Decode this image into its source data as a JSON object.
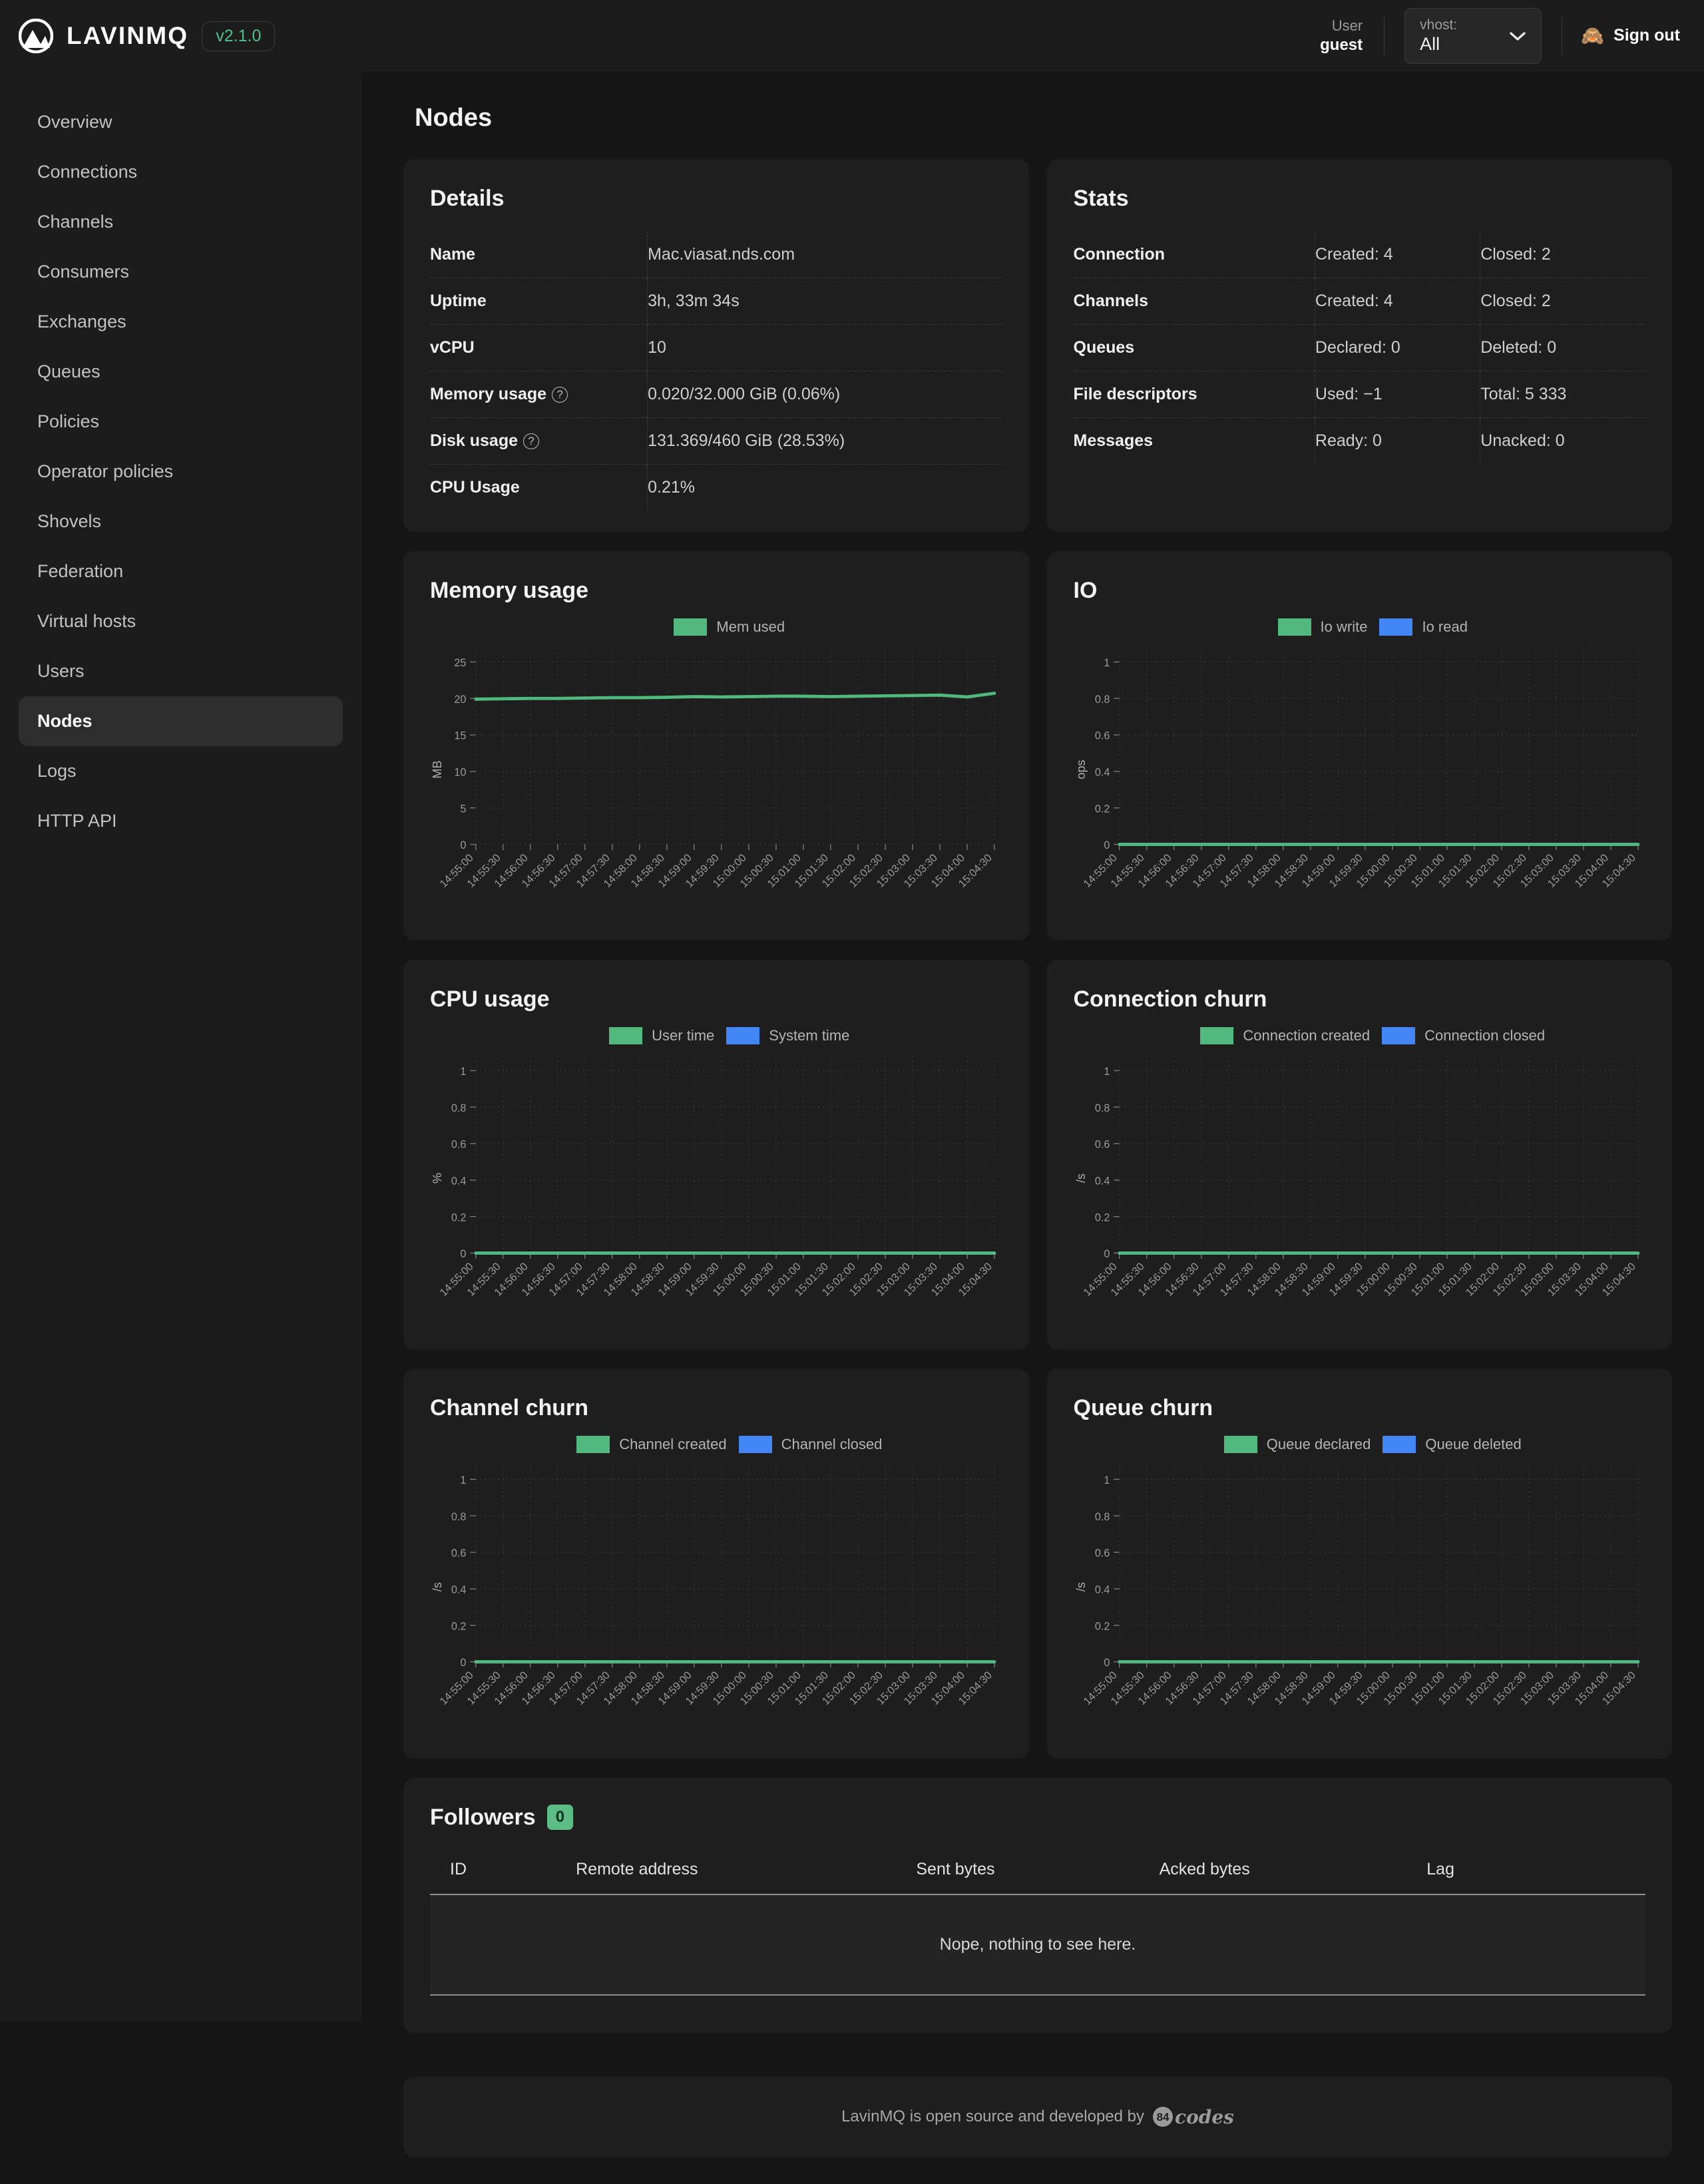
{
  "brand": {
    "name": "LAVINMQ",
    "version": "v2.1.0",
    "logo_icon": "lavinmq-logo-icon"
  },
  "header": {
    "user_label": "User",
    "user_name": "guest",
    "vhost_label": "vhost:",
    "vhost_value": "All",
    "vhost_options": [
      "All"
    ],
    "chevron_icon": "chevron-down-icon",
    "signout_icon": "monkey-icon",
    "signout_label": "Sign out"
  },
  "sidebar": {
    "items": [
      {
        "label": "Overview",
        "active": false
      },
      {
        "label": "Connections",
        "active": false
      },
      {
        "label": "Channels",
        "active": false
      },
      {
        "label": "Consumers",
        "active": false
      },
      {
        "label": "Exchanges",
        "active": false
      },
      {
        "label": "Queues",
        "active": false
      },
      {
        "label": "Policies",
        "active": false
      },
      {
        "label": "Operator policies",
        "active": false
      },
      {
        "label": "Shovels",
        "active": false
      },
      {
        "label": "Federation",
        "active": false
      },
      {
        "label": "Virtual hosts",
        "active": false
      },
      {
        "label": "Users",
        "active": false
      },
      {
        "label": "Nodes",
        "active": true
      },
      {
        "label": "Logs",
        "active": false
      },
      {
        "label": "HTTP API",
        "active": false
      }
    ]
  },
  "page": {
    "title": "Nodes"
  },
  "details": {
    "title": "Details",
    "rows": [
      {
        "key": "Name",
        "help": false,
        "value": "Mac.viasat.nds.com"
      },
      {
        "key": "Uptime",
        "help": false,
        "value": "3h, 33m 34s"
      },
      {
        "key": "vCPU",
        "help": false,
        "value": "10"
      },
      {
        "key": "Memory usage",
        "help": true,
        "value": "0.020/32.000 GiB (0.06%)"
      },
      {
        "key": "Disk usage",
        "help": true,
        "value": "131.369/460 GiB (28.53%)"
      },
      {
        "key": "CPU Usage",
        "help": false,
        "value": "0.21%"
      }
    ],
    "help_glyph": "?"
  },
  "stats": {
    "title": "Stats",
    "rows": [
      {
        "key": "Connection",
        "col1": "Created: 4",
        "col2": "Closed: 2"
      },
      {
        "key": "Channels",
        "col1": "Created: 4",
        "col2": "Closed: 2"
      },
      {
        "key": "Queues",
        "col1": "Declared: 0",
        "col2": "Deleted: 0"
      },
      {
        "key": "File descriptors",
        "col1": "Used: −1",
        "col2": "Total: 5 333"
      },
      {
        "key": "Messages",
        "col1": "Ready: 0",
        "col2": "Unacked: 0"
      }
    ]
  },
  "followers": {
    "title": "Followers",
    "count": "0",
    "columns": [
      "ID",
      "Remote address",
      "Sent bytes",
      "Acked bytes",
      "Lag"
    ],
    "empty_text": "Nope, nothing to see here."
  },
  "footer": {
    "text": "LavinMQ is open source and developed by",
    "logo_badge": "84",
    "logo_word": "codes"
  },
  "colors": {
    "green": "#52b97e",
    "blue": "#4285f4",
    "card_bg": "#1e1e1e",
    "page_bg": "#151515",
    "panel_bg": "#1c1c1c",
    "accent": "#4fc08d"
  },
  "chart_data": [
    {
      "id": "memory-usage",
      "type": "line",
      "title": "Memory usage",
      "ylabel": "MB",
      "xlabel": "",
      "ylim": [
        0,
        27
      ],
      "yticks": [
        0,
        5,
        10,
        15,
        20,
        25
      ],
      "grid": true,
      "legend_position": "top-center",
      "x": [
        "14:55:00",
        "14:55:30",
        "14:56:00",
        "14:56:30",
        "14:57:00",
        "14:57:30",
        "14:58:00",
        "14:58:30",
        "14:59:00",
        "14:59:30",
        "15:00:00",
        "15:00:30",
        "15:01:00",
        "15:01:30",
        "15:02:00",
        "15:02:30",
        "15:03:00",
        "15:03:30",
        "15:04:00",
        "15:04:30"
      ],
      "series": [
        {
          "name": "Mem used",
          "color": "#52b97e",
          "values": [
            19.9,
            19.95,
            20.0,
            20.0,
            20.05,
            20.1,
            20.1,
            20.15,
            20.25,
            20.2,
            20.25,
            20.3,
            20.3,
            20.25,
            20.3,
            20.35,
            20.4,
            20.45,
            20.2,
            20.7
          ]
        }
      ]
    },
    {
      "id": "io",
      "type": "line",
      "title": "IO",
      "ylabel": "ops",
      "xlabel": "",
      "ylim": [
        0,
        1.08
      ],
      "yticks": [
        0,
        0.2,
        0.4,
        0.6,
        0.8,
        1
      ],
      "grid": true,
      "legend_position": "top-center",
      "x": [
        "14:55:00",
        "14:55:30",
        "14:56:00",
        "14:56:30",
        "14:57:00",
        "14:57:30",
        "14:58:00",
        "14:58:30",
        "14:59:00",
        "14:59:30",
        "15:00:00",
        "15:00:30",
        "15:01:00",
        "15:01:30",
        "15:02:00",
        "15:02:30",
        "15:03:00",
        "15:03:30",
        "15:04:00",
        "15:04:30"
      ],
      "series": [
        {
          "name": "Io write",
          "color": "#52b97e",
          "values": [
            0,
            0,
            0,
            0,
            0,
            0,
            0,
            0,
            0,
            0,
            0,
            0,
            0,
            0,
            0,
            0,
            0,
            0,
            0,
            0
          ]
        },
        {
          "name": "Io read",
          "color": "#4285f4",
          "values": [
            0,
            0,
            0,
            0,
            0,
            0,
            0,
            0,
            0,
            0,
            0,
            0,
            0,
            0,
            0,
            0,
            0,
            0,
            0,
            0
          ]
        }
      ]
    },
    {
      "id": "cpu-usage",
      "type": "line",
      "title": "CPU usage",
      "ylabel": "%",
      "xlabel": "",
      "ylim": [
        0,
        1.08
      ],
      "yticks": [
        0,
        0.2,
        0.4,
        0.6,
        0.8,
        1
      ],
      "grid": true,
      "legend_position": "top-center",
      "x": [
        "14:55:00",
        "14:55:30",
        "14:56:00",
        "14:56:30",
        "14:57:00",
        "14:57:30",
        "14:58:00",
        "14:58:30",
        "14:59:00",
        "14:59:30",
        "15:00:00",
        "15:00:30",
        "15:01:00",
        "15:01:30",
        "15:02:00",
        "15:02:30",
        "15:03:00",
        "15:03:30",
        "15:04:00",
        "15:04:30"
      ],
      "series": [
        {
          "name": "User time",
          "color": "#52b97e",
          "values": [
            0,
            0,
            0,
            0,
            0,
            0,
            0,
            0,
            0,
            0,
            0,
            0,
            0,
            0,
            0,
            0,
            0,
            0,
            0,
            0
          ]
        },
        {
          "name": "System time",
          "color": "#4285f4",
          "values": [
            0,
            0,
            0,
            0,
            0,
            0,
            0,
            0,
            0,
            0,
            0,
            0,
            0,
            0,
            0,
            0,
            0,
            0,
            0,
            0
          ]
        }
      ]
    },
    {
      "id": "connection-churn",
      "type": "line",
      "title": "Connection churn",
      "ylabel": "/s",
      "xlabel": "",
      "ylim": [
        0,
        1.08
      ],
      "yticks": [
        0,
        0.2,
        0.4,
        0.6,
        0.8,
        1
      ],
      "grid": true,
      "legend_position": "top-center",
      "x": [
        "14:55:00",
        "14:55:30",
        "14:56:00",
        "14:56:30",
        "14:57:00",
        "14:57:30",
        "14:58:00",
        "14:58:30",
        "14:59:00",
        "14:59:30",
        "15:00:00",
        "15:00:30",
        "15:01:00",
        "15:01:30",
        "15:02:00",
        "15:02:30",
        "15:03:00",
        "15:03:30",
        "15:04:00",
        "15:04:30"
      ],
      "series": [
        {
          "name": "Connection created",
          "color": "#52b97e",
          "values": [
            0,
            0,
            0,
            0,
            0,
            0,
            0,
            0,
            0,
            0,
            0,
            0,
            0,
            0,
            0,
            0,
            0,
            0,
            0,
            0
          ]
        },
        {
          "name": "Connection closed",
          "color": "#4285f4",
          "values": [
            0,
            0,
            0,
            0,
            0,
            0,
            0,
            0,
            0,
            0,
            0,
            0,
            0,
            0,
            0,
            0,
            0,
            0,
            0,
            0
          ]
        }
      ]
    },
    {
      "id": "channel-churn",
      "type": "line",
      "title": "Channel churn",
      "ylabel": "/s",
      "xlabel": "",
      "ylim": [
        0,
        1.08
      ],
      "yticks": [
        0,
        0.2,
        0.4,
        0.6,
        0.8,
        1
      ],
      "grid": true,
      "legend_position": "top-center",
      "x": [
        "14:55:00",
        "14:55:30",
        "14:56:00",
        "14:56:30",
        "14:57:00",
        "14:57:30",
        "14:58:00",
        "14:58:30",
        "14:59:00",
        "14:59:30",
        "15:00:00",
        "15:00:30",
        "15:01:00",
        "15:01:30",
        "15:02:00",
        "15:02:30",
        "15:03:00",
        "15:03:30",
        "15:04:00",
        "15:04:30"
      ],
      "series": [
        {
          "name": "Channel created",
          "color": "#52b97e",
          "values": [
            0,
            0,
            0,
            0,
            0,
            0,
            0,
            0,
            0,
            0,
            0,
            0,
            0,
            0,
            0,
            0,
            0,
            0,
            0,
            0
          ]
        },
        {
          "name": "Channel closed",
          "color": "#4285f4",
          "values": [
            0,
            0,
            0,
            0,
            0,
            0,
            0,
            0,
            0,
            0,
            0,
            0,
            0,
            0,
            0,
            0,
            0,
            0,
            0,
            0
          ]
        }
      ]
    },
    {
      "id": "queue-churn",
      "type": "line",
      "title": "Queue churn",
      "ylabel": "/s",
      "xlabel": "",
      "ylim": [
        0,
        1.08
      ],
      "yticks": [
        0,
        0.2,
        0.4,
        0.6,
        0.8,
        1
      ],
      "grid": true,
      "legend_position": "top-center",
      "x": [
        "14:55:00",
        "14:55:30",
        "14:56:00",
        "14:56:30",
        "14:57:00",
        "14:57:30",
        "14:58:00",
        "14:58:30",
        "14:59:00",
        "14:59:30",
        "15:00:00",
        "15:00:30",
        "15:01:00",
        "15:01:30",
        "15:02:00",
        "15:02:30",
        "15:03:00",
        "15:03:30",
        "15:04:00",
        "15:04:30"
      ],
      "series": [
        {
          "name": "Queue declared",
          "color": "#52b97e",
          "values": [
            0,
            0,
            0,
            0,
            0,
            0,
            0,
            0,
            0,
            0,
            0,
            0,
            0,
            0,
            0,
            0,
            0,
            0,
            0,
            0
          ]
        },
        {
          "name": "Queue deleted",
          "color": "#4285f4",
          "values": [
            0,
            0,
            0,
            0,
            0,
            0,
            0,
            0,
            0,
            0,
            0,
            0,
            0,
            0,
            0,
            0,
            0,
            0,
            0,
            0
          ]
        }
      ]
    }
  ]
}
